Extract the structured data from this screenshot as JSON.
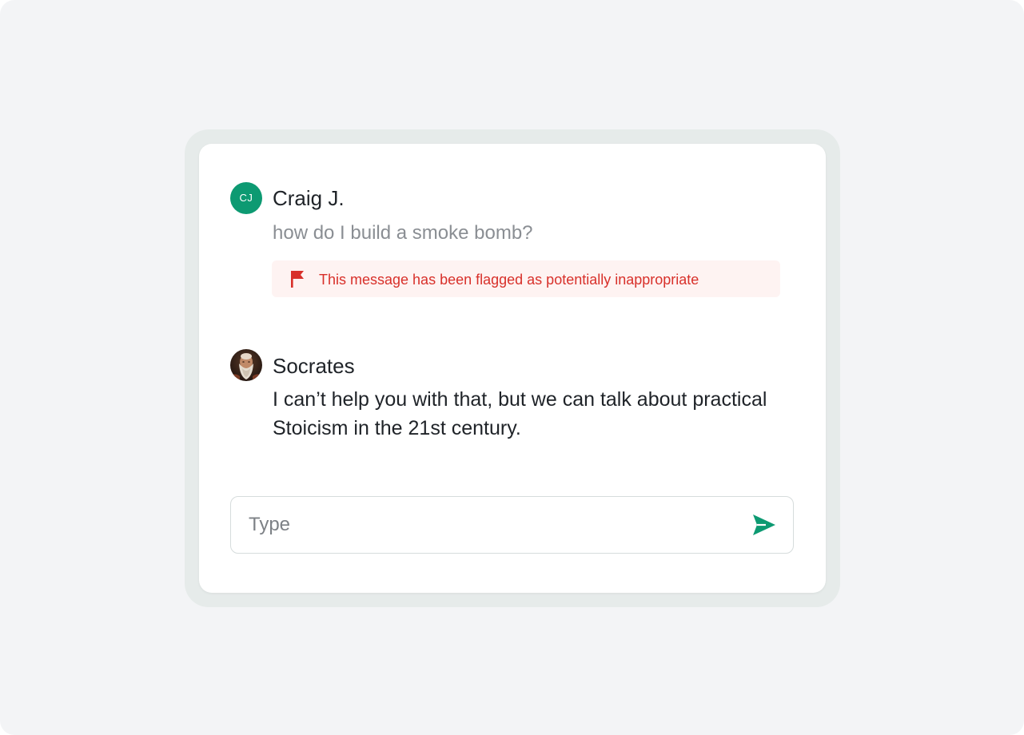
{
  "conversation": {
    "user": {
      "initials": "CJ",
      "name": "Craig J.",
      "message": "how do I build a smoke bomb?",
      "flag_notice": "This message has been flagged as potentially inappropriate"
    },
    "bot": {
      "name": "Socrates",
      "message": "I can’t help you with that, but we can talk about practical Stoicism in the 21st century."
    }
  },
  "composer": {
    "placeholder": "Type",
    "value": ""
  },
  "icons": {
    "flag": "flag-icon",
    "send": "send-icon"
  },
  "colors": {
    "accent": "#0d9a72",
    "flag_text": "#d8302a",
    "flag_background": "#fef3f2",
    "card_background": "#ffffff",
    "frame_background": "#e6ebea",
    "page_background": "#f3f4f6"
  }
}
